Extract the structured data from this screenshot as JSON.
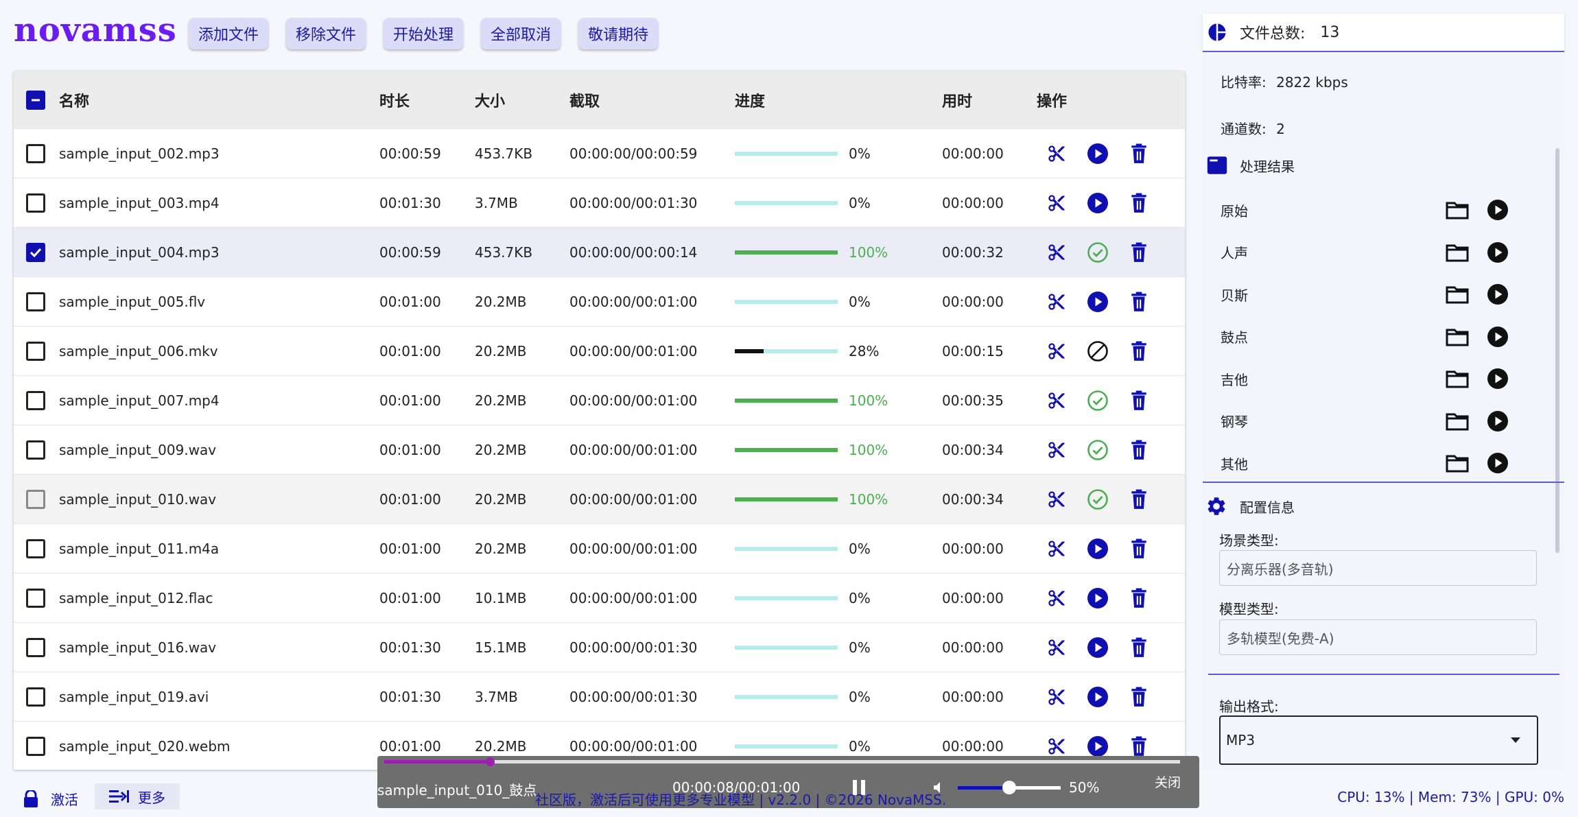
{
  "app": {
    "logo": "novamss"
  },
  "toolbar": {
    "buttons": [
      {
        "label": "添加文件"
      },
      {
        "label": "移除文件"
      },
      {
        "label": "开始处理"
      },
      {
        "label": "全部取消"
      },
      {
        "label": "敬请期待"
      }
    ]
  },
  "table": {
    "headers": {
      "name": "名称",
      "duration": "时长",
      "size": "大小",
      "clip": "截取",
      "progress": "进度",
      "elapsed": "用时",
      "actions": "操作"
    },
    "rows": [
      {
        "name": "sample_input_002.mp3",
        "duration": "00:00:59",
        "size": "453.7KB",
        "clip": "00:00:00/00:00:59",
        "progress": 0,
        "progress_text": "0%",
        "elapsed": "00:00:00",
        "status": "play",
        "checked": "no"
      },
      {
        "name": "sample_input_003.mp4",
        "duration": "00:01:30",
        "size": "3.7MB",
        "clip": "00:00:00/00:01:30",
        "progress": 0,
        "progress_text": "0%",
        "elapsed": "00:00:00",
        "status": "play",
        "checked": "no"
      },
      {
        "name": "sample_input_004.mp3",
        "duration": "00:00:59",
        "size": "453.7KB",
        "clip": "00:00:00/00:00:14",
        "progress": 100,
        "progress_text": "100%",
        "elapsed": "00:00:32",
        "status": "done",
        "checked": "yes"
      },
      {
        "name": "sample_input_005.flv",
        "duration": "00:01:00",
        "size": "20.2MB",
        "clip": "00:00:00/00:01:00",
        "progress": 0,
        "progress_text": "0%",
        "elapsed": "00:00:00",
        "status": "play",
        "checked": "no"
      },
      {
        "name": "sample_input_006.mkv",
        "duration": "00:01:00",
        "size": "20.2MB",
        "clip": "00:00:00/00:01:00",
        "progress": 28,
        "progress_text": "28%",
        "elapsed": "00:00:15",
        "status": "cancel",
        "checked": "no"
      },
      {
        "name": "sample_input_007.mp4",
        "duration": "00:01:00",
        "size": "20.2MB",
        "clip": "00:00:00/00:01:00",
        "progress": 100,
        "progress_text": "100%",
        "elapsed": "00:00:35",
        "status": "done",
        "checked": "no"
      },
      {
        "name": "sample_input_009.wav",
        "duration": "00:01:00",
        "size": "20.2MB",
        "clip": "00:00:00/00:01:00",
        "progress": 100,
        "progress_text": "100%",
        "elapsed": "00:00:34",
        "status": "done",
        "checked": "no"
      },
      {
        "name": "sample_input_010.wav",
        "duration": "00:01:00",
        "size": "20.2MB",
        "clip": "00:00:00/00:01:00",
        "progress": 100,
        "progress_text": "100%",
        "elapsed": "00:00:34",
        "status": "done",
        "checked": "dim"
      },
      {
        "name": "sample_input_011.m4a",
        "duration": "00:01:00",
        "size": "20.2MB",
        "clip": "00:00:00/00:01:00",
        "progress": 0,
        "progress_text": "0%",
        "elapsed": "00:00:00",
        "status": "play",
        "checked": "no"
      },
      {
        "name": "sample_input_012.flac",
        "duration": "00:01:00",
        "size": "10.1MB",
        "clip": "00:00:00/00:01:00",
        "progress": 0,
        "progress_text": "0%",
        "elapsed": "00:00:00",
        "status": "play",
        "checked": "no"
      },
      {
        "name": "sample_input_016.wav",
        "duration": "00:01:30",
        "size": "15.1MB",
        "clip": "00:00:00/00:01:30",
        "progress": 0,
        "progress_text": "0%",
        "elapsed": "00:00:00",
        "status": "play",
        "checked": "no"
      },
      {
        "name": "sample_input_019.avi",
        "duration": "00:01:30",
        "size": "3.7MB",
        "clip": "00:00:00/00:01:30",
        "progress": 0,
        "progress_text": "0%",
        "elapsed": "00:00:00",
        "status": "play",
        "checked": "no"
      },
      {
        "name": "sample_input_020.webm",
        "duration": "00:01:00",
        "size": "20.2MB",
        "clip": "00:00:00/00:01:00",
        "progress": 0,
        "progress_text": "0%",
        "elapsed": "00:00:00",
        "status": "play",
        "checked": "no"
      }
    ]
  },
  "panel": {
    "file_count_label": "文件总数:",
    "file_count": "13",
    "bitrate_label": "比特率:",
    "bitrate": "2822 kbps",
    "channels_label": "通道数:",
    "channels": "2",
    "results_title": "处理结果",
    "results": [
      "原始",
      "人声",
      "贝斯",
      "鼓点",
      "吉他",
      "钢琴",
      "其他"
    ],
    "config_title": "配置信息",
    "scene_label": "场景类型:",
    "scene_value": "分离乐器(多音轨)",
    "model_label": "模型类型:",
    "model_value": "多轨模型(免费-A)",
    "format_label": "输出格式:",
    "format_value": "MP3"
  },
  "player": {
    "track": "sample_input_010_鼓点",
    "time": "00:00:08/00:01:00",
    "volume_text": "50%",
    "volume": 50,
    "position_fraction": 0.133,
    "close_label": "关闭"
  },
  "status": {
    "activate_label": "激活",
    "more_label": "更多",
    "notice": "社区版，激活后可使用更多专业模型 | v2.2.0 | ©2026 NovaMSS.",
    "cpu": "CPU: 13%",
    "mem": "Mem: 73%",
    "gpu": "GPU: 0%"
  },
  "colors": {
    "accent": "#1010b0",
    "logo": "#6a1df0",
    "success": "#4caf50",
    "bar_bg": "#b7ecec",
    "player_progress": "#9c1fb0"
  }
}
